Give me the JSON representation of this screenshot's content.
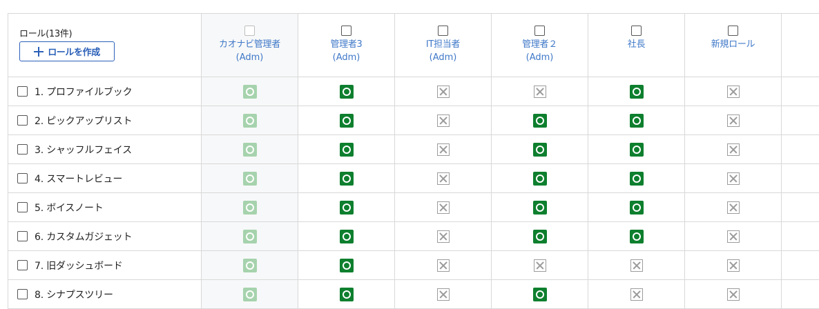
{
  "header": {
    "title": "ロール(13件)",
    "create_button": "ロールを作成"
  },
  "roles": [
    {
      "name": "カオナビ管理者",
      "type": "(Adm)",
      "disabled": true,
      "shaded": true
    },
    {
      "name": "管理者3",
      "type": "(Adm)",
      "disabled": false,
      "shaded": false
    },
    {
      "name": "IT担当者",
      "type": "(Adm)",
      "disabled": false,
      "shaded": false
    },
    {
      "name": "管理者２",
      "type": "(Adm)",
      "disabled": false,
      "shaded": false
    },
    {
      "name": "社長",
      "type": "",
      "disabled": false,
      "shaded": false
    },
    {
      "name": "新規ロール",
      "type": "",
      "disabled": false,
      "shaded": false
    }
  ],
  "rows": [
    {
      "label": "1. プロファイルブック",
      "perms": [
        "allow-faded",
        "allow",
        "deny",
        "deny",
        "allow",
        "deny"
      ]
    },
    {
      "label": "2. ピックアップリスト",
      "perms": [
        "allow-faded",
        "allow",
        "deny",
        "allow",
        "allow",
        "deny"
      ]
    },
    {
      "label": "3. シャッフルフェイス",
      "perms": [
        "allow-faded",
        "allow",
        "deny",
        "allow",
        "allow",
        "deny"
      ]
    },
    {
      "label": "4. スマートレビュー",
      "perms": [
        "allow-faded",
        "allow",
        "deny",
        "allow",
        "allow",
        "deny"
      ]
    },
    {
      "label": "5. ボイスノート",
      "perms": [
        "allow-faded",
        "allow",
        "deny",
        "allow",
        "allow",
        "deny"
      ]
    },
    {
      "label": "6. カスタムガジェット",
      "perms": [
        "allow-faded",
        "allow",
        "deny",
        "allow",
        "allow",
        "deny"
      ]
    },
    {
      "label": "7. 旧ダッシュボード",
      "perms": [
        "allow-faded",
        "allow",
        "deny",
        "deny",
        "deny",
        "deny"
      ]
    },
    {
      "label": "8. シナプスツリー",
      "perms": [
        "allow-faded",
        "allow",
        "deny",
        "allow",
        "deny",
        "deny"
      ]
    }
  ],
  "colors": {
    "allow": "#0e7f2e",
    "allow_faded": "#a6d3ad",
    "deny_border": "#9b9b9b",
    "link_blue": "#3f78c8",
    "accent": "#2a5fb8"
  },
  "icons": {
    "allow": "circle-check-icon",
    "deny": "x-box-icon",
    "create": "plus-icon"
  }
}
